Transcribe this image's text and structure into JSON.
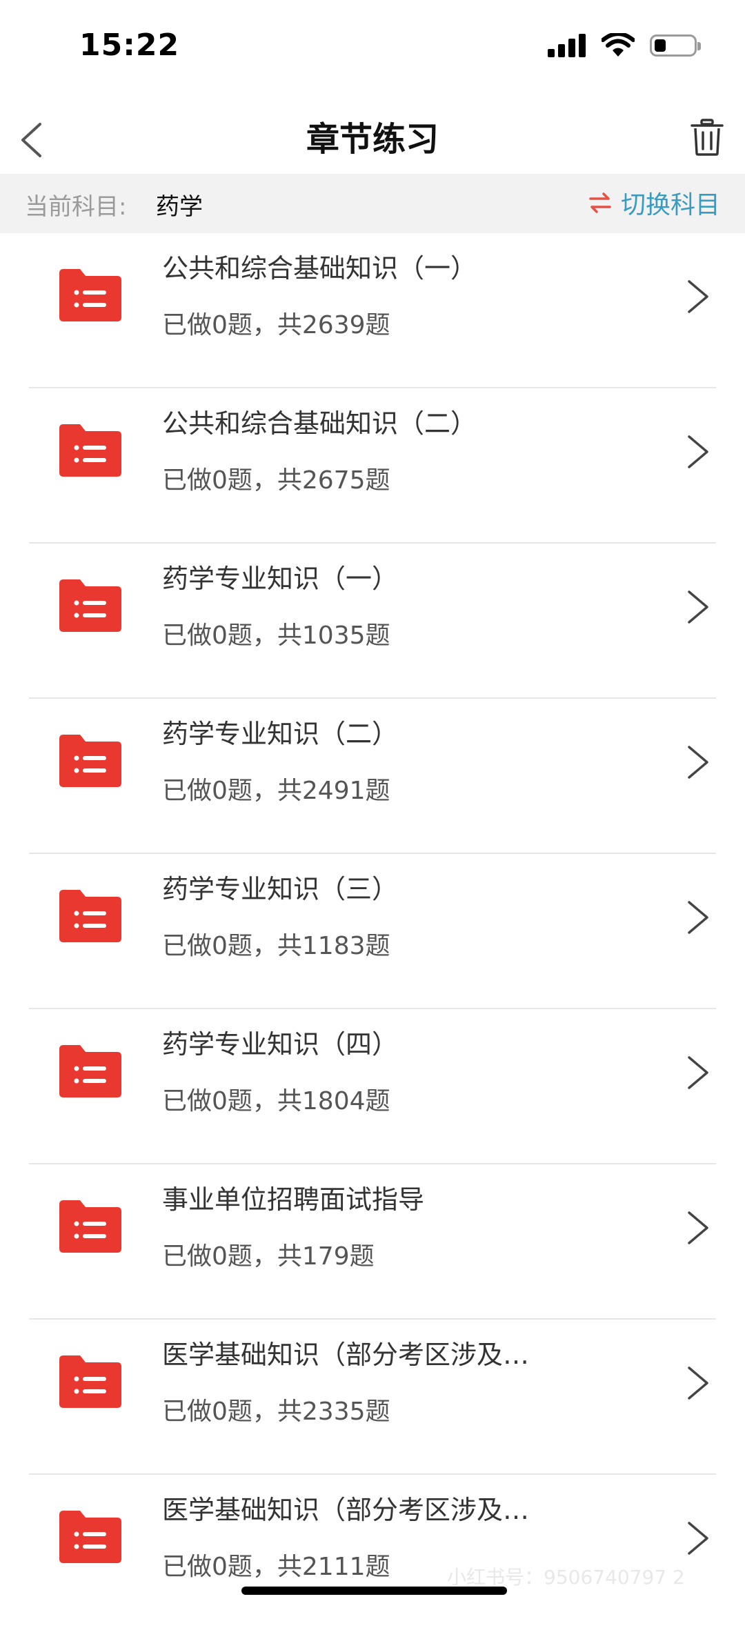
{
  "status": {
    "time": "15:22"
  },
  "nav": {
    "title": "章节练习"
  },
  "subject": {
    "label": "当前科目:",
    "value": "药学",
    "switch_label": "切换科目"
  },
  "colors": {
    "accent_red": "#e8382f",
    "link_blue": "#3a9bc0",
    "switch_icon": "#e25247"
  },
  "items": [
    {
      "title": "公共和综合基础知识（一）",
      "progress": "已做0题，共2639题"
    },
    {
      "title": "公共和综合基础知识（二）",
      "progress": "已做0题，共2675题"
    },
    {
      "title": "药学专业知识（一）",
      "progress": "已做0题，共1035题"
    },
    {
      "title": "药学专业知识（二）",
      "progress": "已做0题，共2491题"
    },
    {
      "title": "药学专业知识（三）",
      "progress": "已做0题，共1183题"
    },
    {
      "title": "药学专业知识（四）",
      "progress": "已做0题，共1804题"
    },
    {
      "title": "事业单位招聘面试指导",
      "progress": "已做0题，共179题"
    },
    {
      "title": "医学基础知识（部分考区涉及…",
      "progress": "已做0题，共2335题"
    },
    {
      "title": "医学基础知识（部分考区涉及…",
      "progress": "已做0题，共2111题"
    }
  ],
  "watermark": "小红书号：9506740797 2"
}
